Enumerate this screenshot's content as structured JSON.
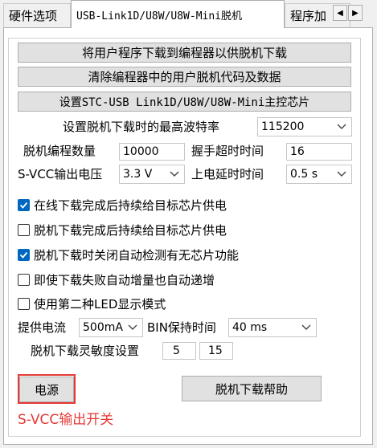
{
  "tabs": [
    {
      "label": "硬件选项"
    },
    {
      "label": "USB-Link1D/U8W/U8W-Mini脱机"
    },
    {
      "label": "程序加"
    }
  ],
  "buttons": {
    "download_to_programmer": "将用户程序下载到编程器以供脱机下载",
    "clear_programmer": "清除编程器中的用户脱机代码及数据",
    "set_master_chip": "设置STC-USB Link1D/U8W/U8W-Mini主控芯片",
    "power": "电源",
    "offline_help": "脱机下载帮助"
  },
  "baud": {
    "label": "设置脱机下载时的最高波特率",
    "value": "115200"
  },
  "prog_count": {
    "label": "脱机编程数量",
    "value": "10000"
  },
  "handshake_timeout": {
    "label": "握手超时时间",
    "value": "16"
  },
  "svcc_voltage": {
    "label": "S-VCC输出电压",
    "value": "3.3 V"
  },
  "power_on_delay": {
    "label": "上电延时时间",
    "value": "0.5 s"
  },
  "checkboxes": [
    {
      "label": "在线下载完成后持续给目标芯片供电",
      "checked": true
    },
    {
      "label": "脱机下载完成后持续给目标芯片供电",
      "checked": false
    },
    {
      "label": "脱机下载时关闭自动检测有无芯片功能",
      "checked": true
    },
    {
      "label": "即使下载失败自动增量也自动递增",
      "checked": false
    },
    {
      "label": "使用第二种LED显示模式",
      "checked": false
    }
  ],
  "supply_current": {
    "label": "提供电流",
    "value": "500mA"
  },
  "bin_hold": {
    "label": "BIN保持时间",
    "value": "40 ms"
  },
  "sensitivity": {
    "label": "脱机下载灵敏度设置",
    "value1": "5",
    "value2": "15"
  },
  "annotation": "S-VCC输出开关",
  "colors": {
    "accent": "#0067c0",
    "highlight": "#e53935"
  }
}
